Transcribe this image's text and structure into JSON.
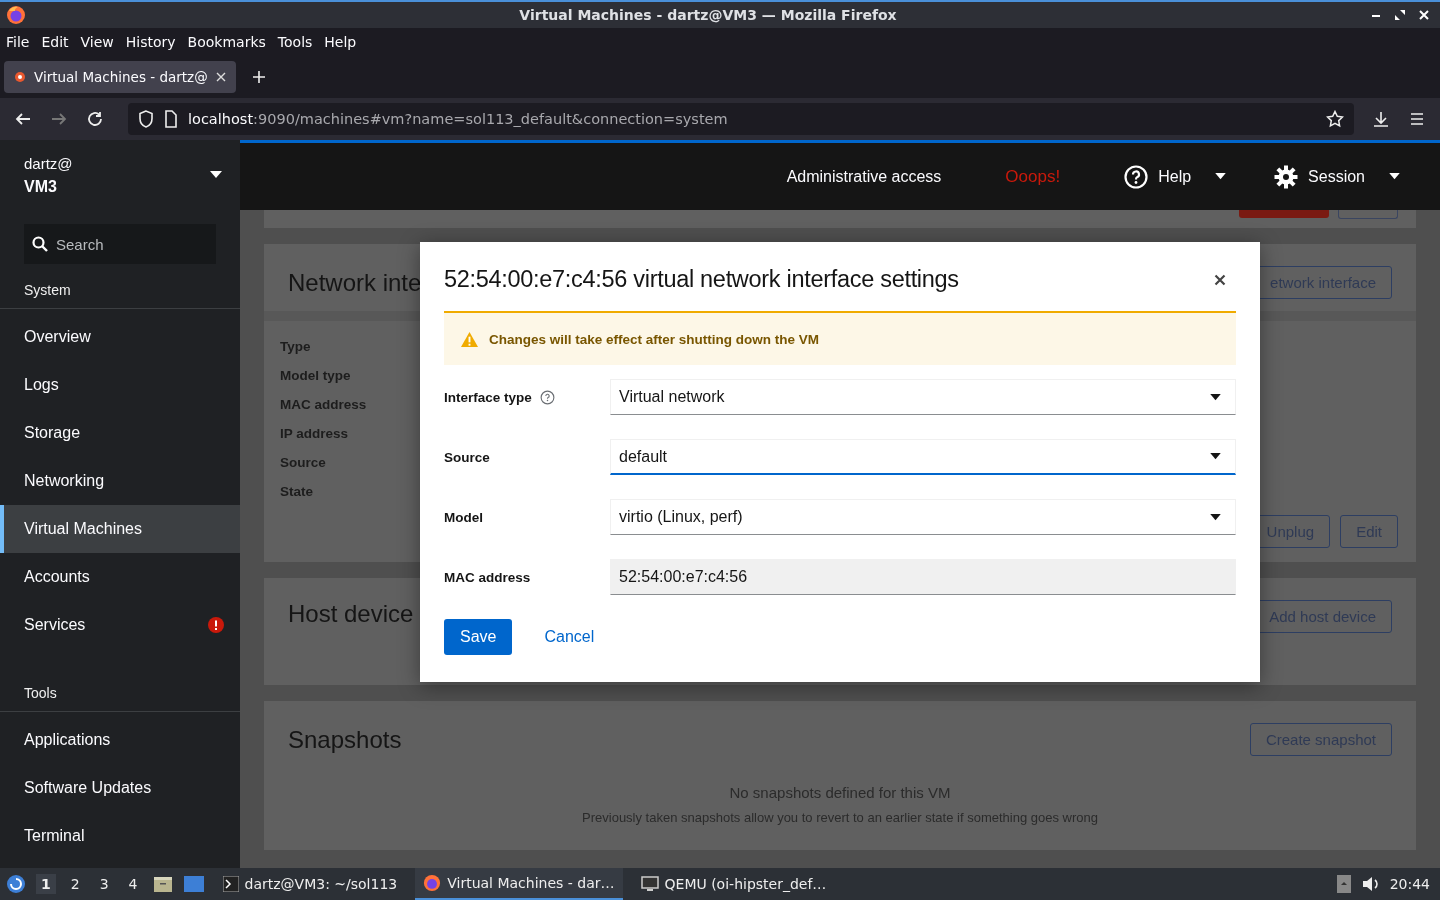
{
  "window": {
    "title": "Virtual Machines - dartz@VM3 — Mozilla Firefox"
  },
  "menu": [
    "File",
    "Edit",
    "View",
    "History",
    "Bookmarks",
    "Tools",
    "Help"
  ],
  "tabs": [
    {
      "label": "Virtual Machines - dartz@",
      "selected": true
    }
  ],
  "nav_buttons": [
    {
      "kind": "back",
      "disabled": false
    },
    {
      "kind": "forward",
      "disabled": true
    },
    {
      "kind": "reload",
      "disabled": false
    }
  ],
  "address": {
    "host": "localhost",
    "path": ":9090/machines#vm?name=sol113_default&connection=system"
  },
  "sidebar": {
    "user": "dartz@",
    "host": "VM3",
    "search_placeholder": "Search",
    "sections": [
      {
        "title": "System",
        "items": [
          {
            "label": "Overview",
            "selected": false,
            "alert": false
          },
          {
            "label": "Logs",
            "selected": false,
            "alert": false
          },
          {
            "label": "Storage",
            "selected": false,
            "alert": false
          },
          {
            "label": "Networking",
            "selected": false,
            "alert": false
          },
          {
            "label": "Virtual Machines",
            "selected": true,
            "alert": false
          },
          {
            "label": "Accounts",
            "selected": false,
            "alert": false
          },
          {
            "label": "Services",
            "selected": false,
            "alert": true
          }
        ]
      },
      {
        "title": "Tools",
        "items": [
          {
            "label": "Applications",
            "selected": false,
            "alert": false
          },
          {
            "label": "Software Updates",
            "selected": false,
            "alert": false
          },
          {
            "label": "Terminal",
            "selected": false,
            "alert": false
          }
        ]
      }
    ]
  },
  "masthead": {
    "access": "Administrative access",
    "error": "Ooops!",
    "help": "Help",
    "session": "Session"
  },
  "page": {
    "network": {
      "title": "Network inte",
      "button": "etwork interface",
      "fields": [
        "Type",
        "Model type",
        "MAC address",
        "IP address",
        "Source",
        "State"
      ],
      "actions": [
        "Unplug",
        "Edit"
      ]
    },
    "host_devices": {
      "title": "Host device",
      "button": "Add host device"
    },
    "snapshots": {
      "title": "Snapshots",
      "button": "Create snapshot",
      "empty_title": "No snapshots defined for this VM",
      "empty_text": "Previously taken snapshots allow you to revert to an earlier state if something goes wrong"
    }
  },
  "dialog": {
    "title": "52:54:00:e7:c4:56 virtual network interface settings",
    "alert": "Changes will take effect after shutting down the VM",
    "fields": [
      {
        "label": "Interface type",
        "kind": "select",
        "value": "Virtual network",
        "help": true,
        "focused": false
      },
      {
        "label": "Source",
        "kind": "select",
        "value": "default",
        "help": false,
        "focused": true
      },
      {
        "label": "Model",
        "kind": "select",
        "value": "virtio (Linux, perf)",
        "help": false,
        "focused": false
      },
      {
        "label": "MAC address",
        "kind": "text",
        "value": "52:54:00:e7:c4:56",
        "help": false,
        "focused": false
      }
    ],
    "save": "Save",
    "cancel": "Cancel"
  },
  "taskbar": {
    "workspaces": [
      {
        "label": "1",
        "selected": true
      },
      {
        "label": "2",
        "selected": false
      },
      {
        "label": "3",
        "selected": false
      },
      {
        "label": "4",
        "selected": false
      }
    ],
    "tasks": [
      {
        "label": "dartz@VM3: ~/sol113",
        "kind": "terminal",
        "selected": false
      },
      {
        "label": "Virtual Machines - dar…",
        "kind": "browser",
        "selected": true
      },
      {
        "label": "QEMU (oi-hipster_def…",
        "kind": "monitor",
        "selected": false
      }
    ],
    "clock": "20:44"
  }
}
